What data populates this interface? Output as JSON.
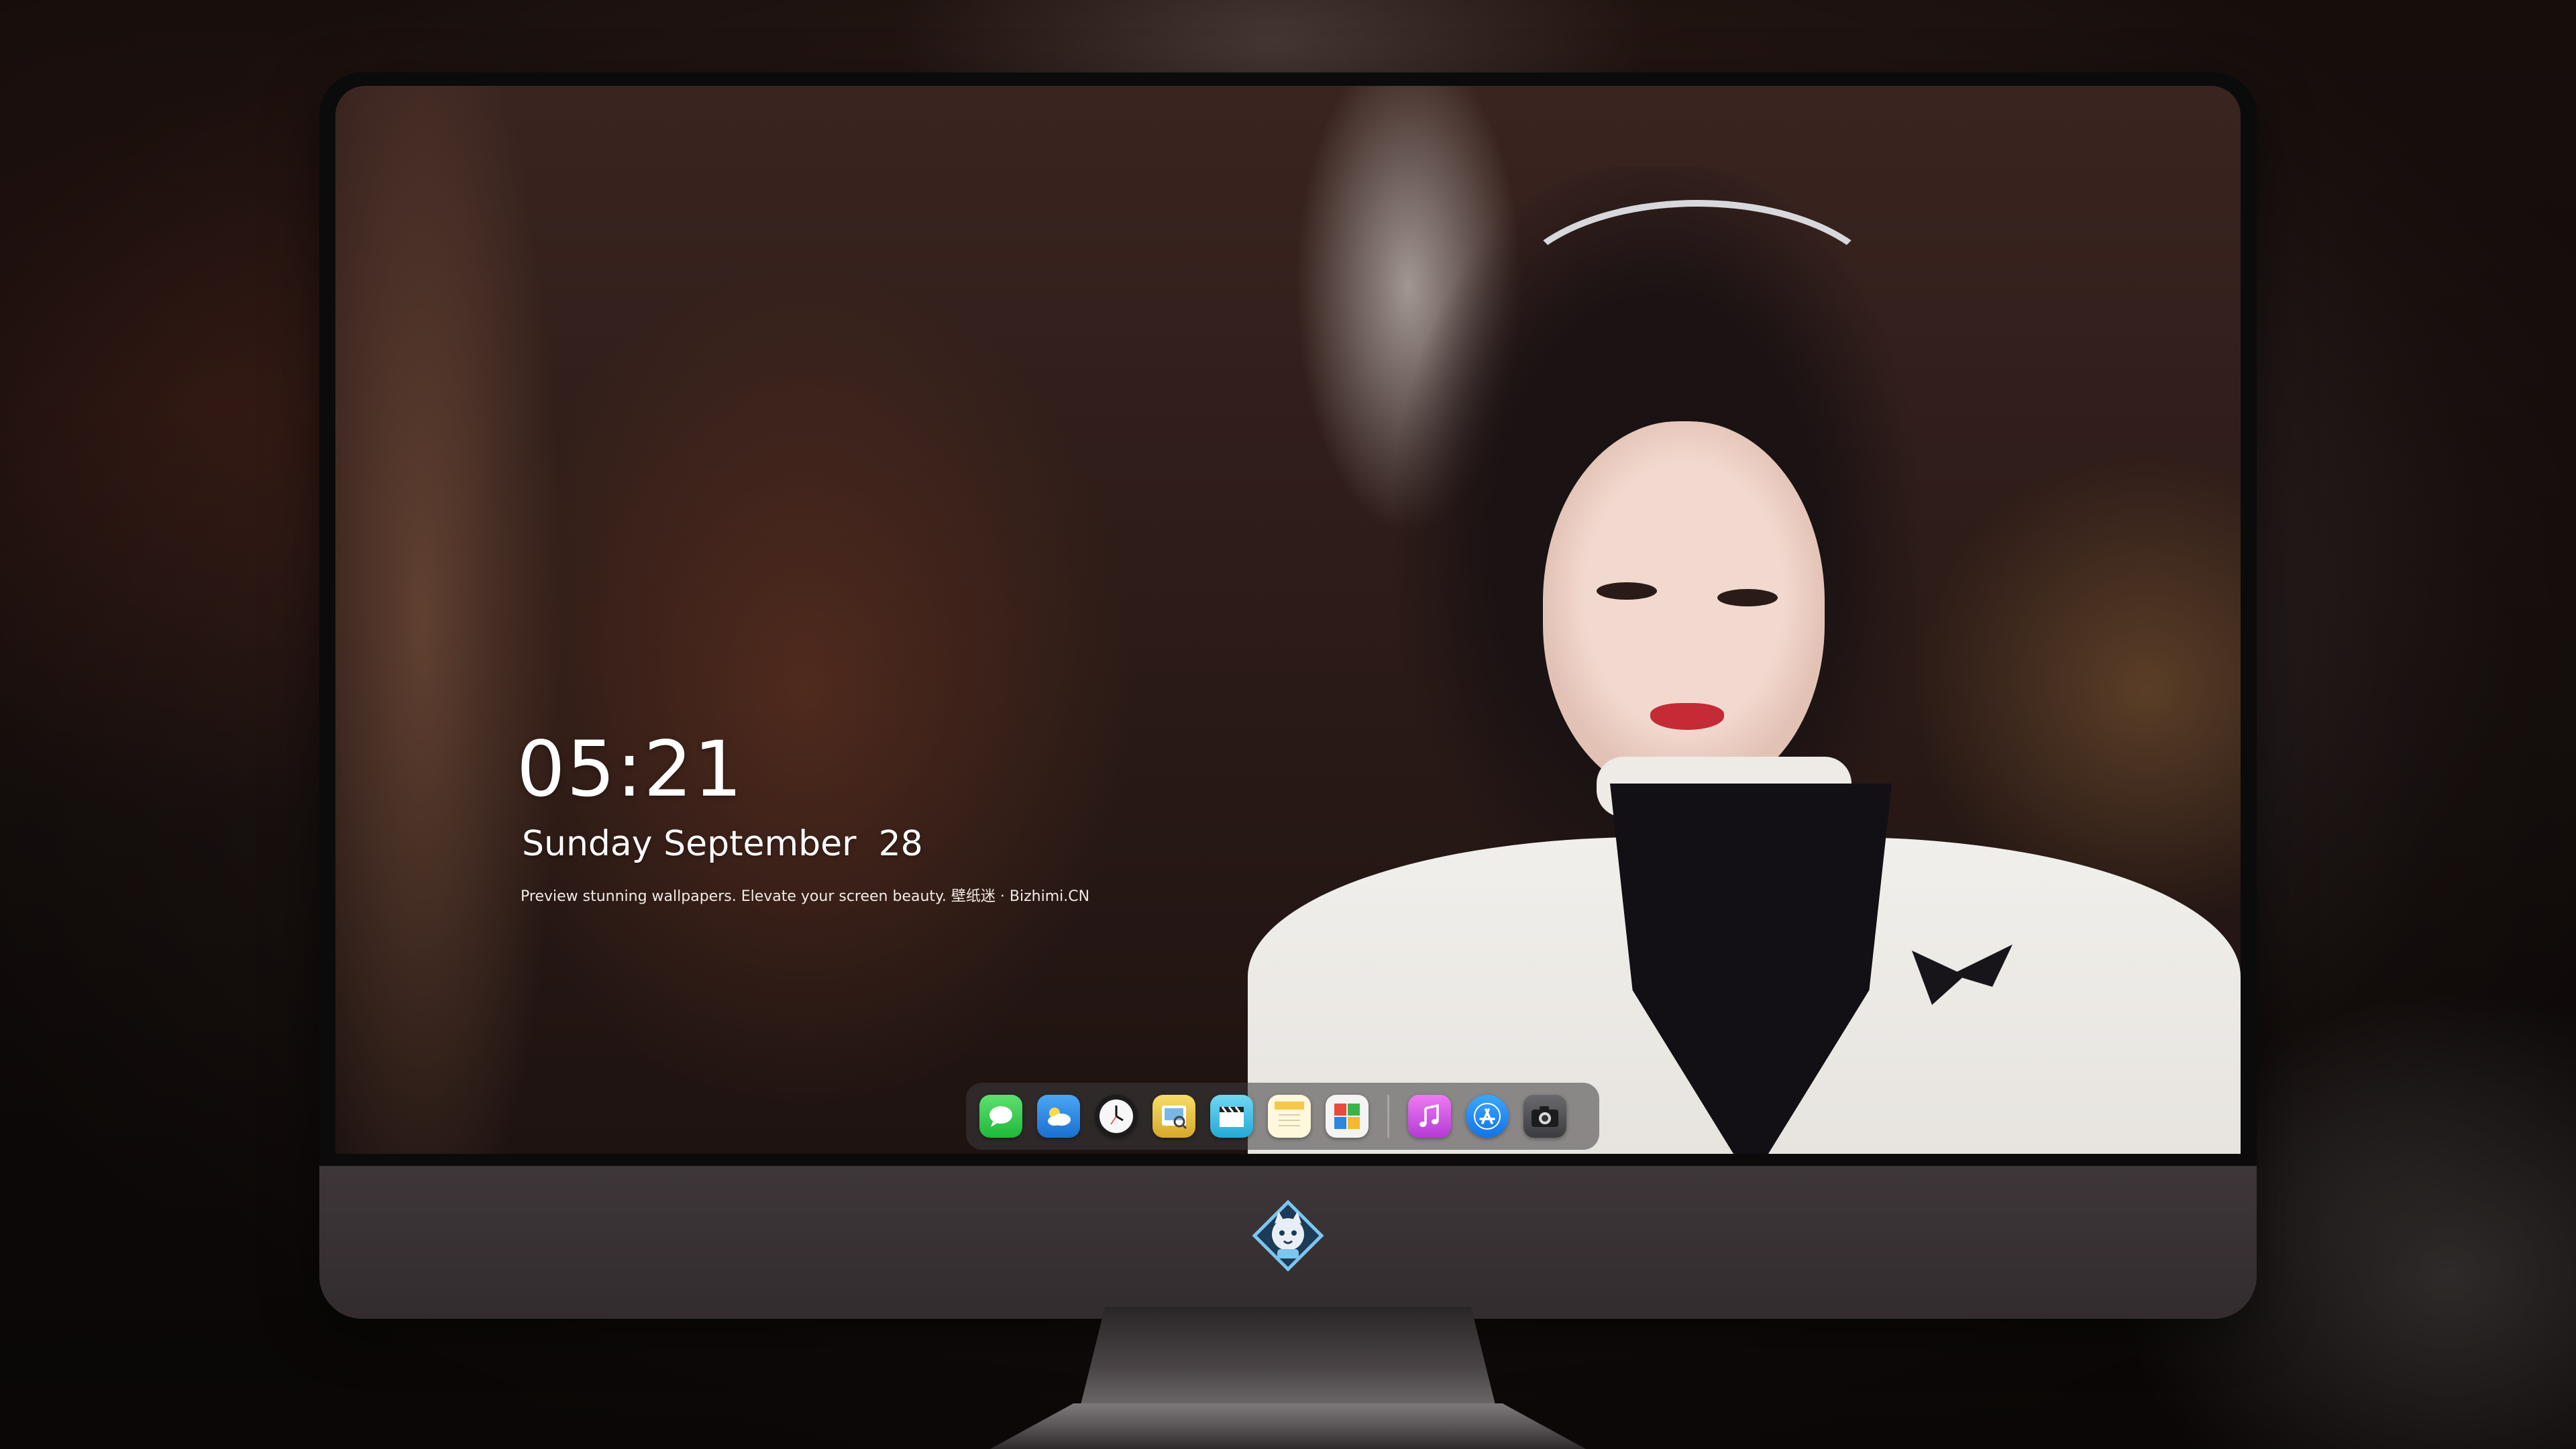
{
  "clock": {
    "time": "05:21",
    "date": "Sunday September  28",
    "caption": "Preview stunning wallpapers. Elevate your screen beauty. 壁纸迷 · Bizhimi.CN"
  },
  "dock": {
    "left_apps": [
      {
        "name": "Messages",
        "icon": "messages-icon",
        "color": "#2fcf4a"
      },
      {
        "name": "Weather",
        "icon": "weather-icon",
        "color": "#2b86e6"
      },
      {
        "name": "Clock",
        "icon": "clock-icon",
        "color": "#f5f5f5"
      },
      {
        "name": "Preview",
        "icon": "preview-icon",
        "color": "#e9c84a"
      },
      {
        "name": "Clips",
        "icon": "clapperboard-icon",
        "color": "#3fc3e6"
      },
      {
        "name": "Notes",
        "icon": "notes-icon",
        "color": "#f6d36a"
      },
      {
        "name": "Photo Booth",
        "icon": "photo-grid-icon",
        "color": "#e94b3c"
      }
    ],
    "right_apps": [
      {
        "name": "iTunes",
        "icon": "music-note-icon",
        "color": "#d44fe0"
      },
      {
        "name": "App Store",
        "icon": "app-store-icon",
        "color": "#1d8ef2"
      },
      {
        "name": "Camera",
        "icon": "camera-icon",
        "color": "#5a5a5e"
      }
    ]
  },
  "chin": {
    "logo": "kitten-mascot-logo"
  },
  "colors": {
    "frame": "#0b0b0c",
    "chin": "#3a3234",
    "dock_bg": "rgba(60,58,60,0.55)"
  }
}
